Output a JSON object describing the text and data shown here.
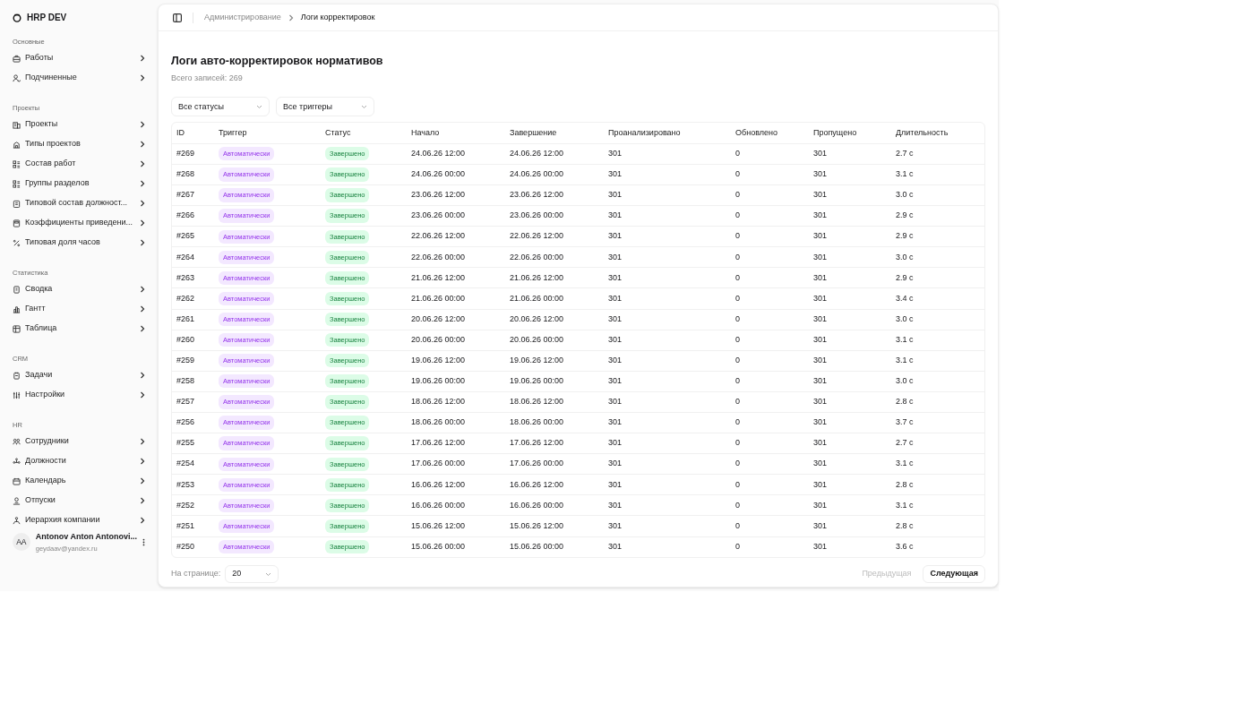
{
  "sidebar": {
    "brand": "HRP DEV",
    "groups": [
      {
        "label": "Основные",
        "items": [
          "Работы",
          "Подчиненные"
        ]
      },
      {
        "label": "Проекты",
        "items": [
          "Проекты",
          "Типы проектов",
          "Состав работ",
          "Группы разделов",
          "Типовой состав должност...",
          "Коэффициенты приведени...",
          "Типовая доля часов"
        ]
      },
      {
        "label": "Статистика",
        "items": [
          "Сводка",
          "Гантт",
          "Таблица"
        ]
      },
      {
        "label": "CRM",
        "items": [
          "Задачи",
          "Настройки"
        ]
      },
      {
        "label": "HR",
        "items": [
          "Сотрудники",
          "Должности",
          "Календарь",
          "Отпуски",
          "Иерархия компании"
        ]
      }
    ],
    "user": {
      "initials": "AA",
      "name": "Antonov Anton Antonovi...",
      "email": "geydaav@yandex.ru"
    }
  },
  "breadcrumbs": [
    "Администрирование",
    "Логи корректировок"
  ],
  "page": {
    "title": "Логи авто-корректировок нормативов",
    "subtitle": "Всего записей: 269"
  },
  "filters": [
    "Все статусы",
    "Все триггеры"
  ],
  "table": {
    "columns": [
      "ID",
      "Триггер",
      "Статус",
      "Начало",
      "Завершение",
      "Проанализировано",
      "Обновлено",
      "Пропущено",
      "Длительность"
    ],
    "rows": [
      [
        "#269",
        "Автоматически",
        "Завершено",
        "24.06.26 12:00",
        "24.06.26 12:00",
        "301",
        "0",
        "301",
        "2.7 с"
      ],
      [
        "#268",
        "Автоматически",
        "Завершено",
        "24.06.26 00:00",
        "24.06.26 00:00",
        "301",
        "0",
        "301",
        "3.1 с"
      ],
      [
        "#267",
        "Автоматически",
        "Завершено",
        "23.06.26 12:00",
        "23.06.26 12:00",
        "301",
        "0",
        "301",
        "3.0 с"
      ],
      [
        "#266",
        "Автоматически",
        "Завершено",
        "23.06.26 00:00",
        "23.06.26 00:00",
        "301",
        "0",
        "301",
        "2.9 с"
      ],
      [
        "#265",
        "Автоматически",
        "Завершено",
        "22.06.26 12:00",
        "22.06.26 12:00",
        "301",
        "0",
        "301",
        "2.9 с"
      ],
      [
        "#264",
        "Автоматически",
        "Завершено",
        "22.06.26 00:00",
        "22.06.26 00:00",
        "301",
        "0",
        "301",
        "3.0 с"
      ],
      [
        "#263",
        "Автоматически",
        "Завершено",
        "21.06.26 12:00",
        "21.06.26 12:00",
        "301",
        "0",
        "301",
        "2.9 с"
      ],
      [
        "#262",
        "Автоматически",
        "Завершено",
        "21.06.26 00:00",
        "21.06.26 00:00",
        "301",
        "0",
        "301",
        "3.4 с"
      ],
      [
        "#261",
        "Автоматически",
        "Завершено",
        "20.06.26 12:00",
        "20.06.26 12:00",
        "301",
        "0",
        "301",
        "3.0 с"
      ],
      [
        "#260",
        "Автоматически",
        "Завершено",
        "20.06.26 00:00",
        "20.06.26 00:00",
        "301",
        "0",
        "301",
        "3.1 с"
      ],
      [
        "#259",
        "Автоматически",
        "Завершено",
        "19.06.26 12:00",
        "19.06.26 12:00",
        "301",
        "0",
        "301",
        "3.1 с"
      ],
      [
        "#258",
        "Автоматически",
        "Завершено",
        "19.06.26 00:00",
        "19.06.26 00:00",
        "301",
        "0",
        "301",
        "3.0 с"
      ],
      [
        "#257",
        "Автоматически",
        "Завершено",
        "18.06.26 12:00",
        "18.06.26 12:00",
        "301",
        "0",
        "301",
        "2.8 с"
      ],
      [
        "#256",
        "Автоматически",
        "Завершено",
        "18.06.26 00:00",
        "18.06.26 00:00",
        "301",
        "0",
        "301",
        "3.7 с"
      ],
      [
        "#255",
        "Автоматически",
        "Завершено",
        "17.06.26 12:00",
        "17.06.26 12:00",
        "301",
        "0",
        "301",
        "2.7 с"
      ],
      [
        "#254",
        "Автоматически",
        "Завершено",
        "17.06.26 00:00",
        "17.06.26 00:00",
        "301",
        "0",
        "301",
        "3.1 с"
      ],
      [
        "#253",
        "Автоматически",
        "Завершено",
        "16.06.26 12:00",
        "16.06.26 12:00",
        "301",
        "0",
        "301",
        "2.8 с"
      ],
      [
        "#252",
        "Автоматически",
        "Завершено",
        "16.06.26 00:00",
        "16.06.26 00:00",
        "301",
        "0",
        "301",
        "3.1 с"
      ],
      [
        "#251",
        "Автоматически",
        "Завершено",
        "15.06.26 12:00",
        "15.06.26 12:00",
        "301",
        "0",
        "301",
        "2.8 с"
      ],
      [
        "#250",
        "Автоматически",
        "Завершено",
        "15.06.26 00:00",
        "15.06.26 00:00",
        "301",
        "0",
        "301",
        "3.6 с"
      ]
    ]
  },
  "pagination": {
    "label": "На странице:",
    "page_size": "20",
    "prev": {
      "label": "Предыдущая",
      "disabled": true
    },
    "next": {
      "label": "Следующая",
      "disabled": false
    }
  }
}
